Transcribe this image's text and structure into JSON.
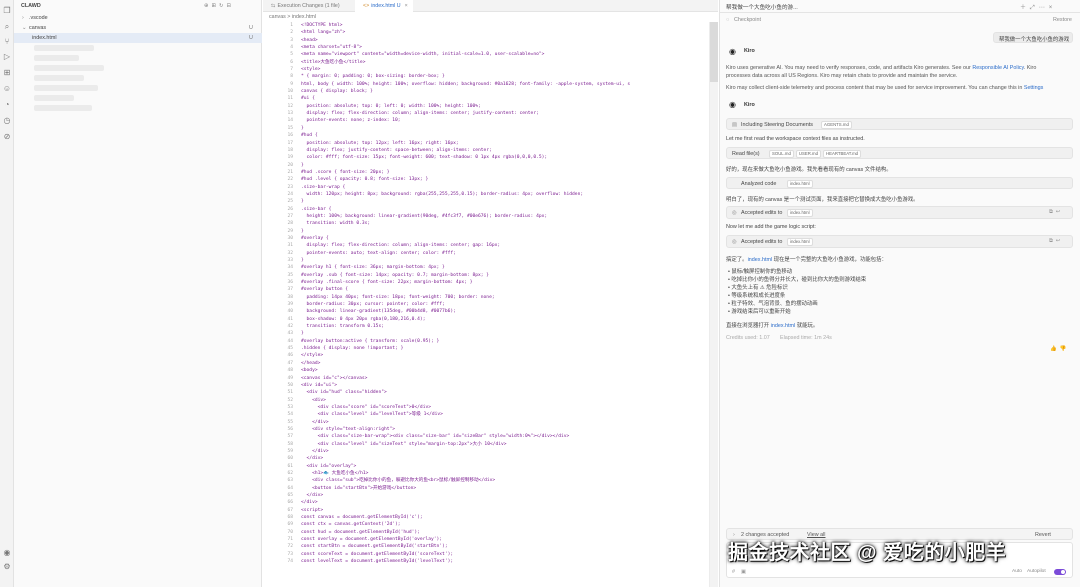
{
  "explorer": {
    "title": "CLAWD",
    "items": [
      {
        "label": ".vscode",
        "badge": ""
      },
      {
        "label": "canvas",
        "badge": "U"
      },
      {
        "label": "index.html",
        "badge": "U"
      }
    ]
  },
  "editor": {
    "tabs": [
      "Execution Changes (1 file)",
      "index.html U"
    ],
    "breadcrumb": "canvas > index.html",
    "lines": [
      "<!DOCTYPE html>",
      "<html lang=\"zh\">",
      "<head>",
      "<meta charset=\"utf-8\">",
      "<meta name=\"viewport\" content=\"width=device-width, initial-scale=1.0, user-scalable=no\">",
      "<title>大鱼吃小鱼</title>",
      "<style>",
      "* { margin: 0; padding: 0; box-sizing: border-box; }",
      "html, body { width: 100%; height: 100%; overflow: hidden; background: #0a1628; font-family: -apple-system, system-ui, s",
      "canvas { display: block; }",
      "#ui {",
      "  position: absolute; top: 0; left: 0; width: 100%; height: 100%;",
      "  display: flex; flex-direction: column; align-items: center; justify-content: center;",
      "  pointer-events: none; z-index: 10;",
      "}",
      "#hud {",
      "  position: absolute; top: 12px; left: 16px; right: 16px;",
      "  display: flex; justify-content: space-between; align-items: center;",
      "  color: #fff; font-size: 15px; font-weight: 600; text-shadow: 0 1px 4px rgba(0,0,0,0.5);",
      "}",
      "#hud .score { font-size: 20px; }",
      "#hud .level { opacity: 0.8; font-size: 13px; }",
      ".size-bar-wrap {",
      "  width: 120px; height: 8px; background: rgba(255,255,255,0.15); border-radius: 4px; overflow: hidden;",
      "}",
      ".size-bar {",
      "  height: 100%; background: linear-gradient(90deg, #4fc3f7, #00e676); border-radius: 4px;",
      "  transition: width 0.3s;",
      "}",
      "#overlay {",
      "  display: flex; flex-direction: column; align-items: center; gap: 16px;",
      "  pointer-events: auto; text-align: center; color: #fff;",
      "}",
      "#overlay h1 { font-size: 36px; margin-bottom: 4px; }",
      "#overlay .sub { font-size: 14px; opacity: 0.7; margin-bottom: 8px; }",
      "#overlay .final-score { font-size: 22px; margin-bottom: 4px; }",
      "#overlay button {",
      "  padding: 14px 40px; font-size: 18px; font-weight: 700; border: none;",
      "  border-radius: 30px; cursor: pointer; color: #fff;",
      "  background: linear-gradient(135deg, #00b4d8, #0077b6);",
      "  box-shadow: 0 4px 20px rgba(0,180,216,0.4);",
      "  transition: transform 0.15s;",
      "}",
      "#overlay button:active { transform: scale(0.95); }",
      ".hidden { display: none !important; }",
      "</style>",
      "</head>",
      "<body>",
      "<canvas id=\"c\"></canvas>",
      "<div id=\"ui\">",
      "  <div id=\"hud\" class=\"hidden\">",
      "    <div>",
      "      <div class=\"score\" id=\"scoreText\">0</div>",
      "      <div class=\"level\" id=\"levelText\">等级 1</div>",
      "    </div>",
      "    <div style=\"text-align:right\">",
      "      <div class=\"size-bar-wrap\"><div class=\"size-bar\" id=\"sizeBar\" style=\"width:0%\"></div></div>",
      "      <div class=\"level\" id=\"sizeText\" style=\"margin-top:2px\">大小 10</div>",
      "    </div>",
      "  </div>",
      "  <div id=\"overlay\">",
      "    <h1>🐟 大鱼吃小鱼</h1>",
      "    <div class=\"sub\">吃掉比你小的鱼，躲避比你大的鱼<br>鼠标/触屏控制移动</div>",
      "    <button id=\"startBtn\">开始游戏</button>",
      "  </div>",
      "</div>",
      "<script>",
      "const canvas = document.getElementById('c');",
      "const ctx = canvas.getContext('2d');",
      "const hud = document.getElementById('hud');",
      "const overlay = document.getElementById('overlay');",
      "const startBtn = document.getElementById('startBtn');",
      "const scoreText = document.getElementById('scoreText');",
      "const levelText = document.getElementById('levelText');"
    ]
  },
  "chat": {
    "header_title": "帮我做一个大鱼吃小鱼的游...",
    "checkpoint": "Checkpoint",
    "restore": "Restore",
    "user_message": "帮我做一个大鱼吃小鱼的游戏",
    "assistant_name": "Kiro",
    "disclaimer1": "Kiro uses generative AI. You may need to verify responses, code, and artifacts Kiro generates. See our ",
    "disclaimer1_link": "Responsible AI Policy",
    "disclaimer1_end": ". Kiro",
    "disclaimer2": "processes data across all US Regions. Kiro may retain chats to provide and maintain the service.",
    "disclaimer3": "Kiro may collect client-side telemetry and process content that may be used for service improvement. You can change this in ",
    "disclaimer3_link": "Settings",
    "steering_label": "Including Steering Documents",
    "steering_chip": "AGENTS.md",
    "msg1": "Let me first read the workspace context files as instructed.",
    "read_label": "Read file(s)",
    "read_chips": [
      "SOUL.md",
      "USER.md",
      "HEARTBEAT.md"
    ],
    "msg2": "好的，现在来做大鱼吃小鱼游戏。我先看看现有的 canvas 文件结构。",
    "analyzed_label": "Analyzed code",
    "analyzed_chip": "index.html",
    "msg3": "明白了，现有的 canvas 是一个测试页面，我来直接把它替换成大鱼吃小鱼游戏。",
    "accepted_label": "Accepted edits to",
    "accepted_chip": "index.html",
    "msg4": "Now let me add the game logic script:",
    "done_prefix": "搞定了。",
    "done_link": "index.html",
    "done_text": " 现在是一个完整的大鱼吃小鱼游戏，功能包括：",
    "bullets": [
      "鼠标/触屏控制你的鱼移动",
      "吃掉比你小的鱼得分并长大，碰到比你大的鱼则游戏结束",
      "大鱼头上有 ⚠ 危险标识",
      "等级系统和成长进度条",
      "粒子特效、气泡背景、鱼的摆动动画",
      "游戏结束后可以重新开始"
    ],
    "open_prefix": "直接在浏览器打开 ",
    "open_link": "index.html",
    "open_suffix": " 就能玩。",
    "credits": "Credits used: 1.07",
    "elapsed": "Elapsed time: 1m 24s",
    "changes_label": "2 changes accepted",
    "view_all": "View all",
    "revert": "Revert",
    "keep_label": "Auto",
    "autopilot": "Autopilot"
  },
  "watermark": "掘金技术社区 @ 爱吃的小肥羊"
}
